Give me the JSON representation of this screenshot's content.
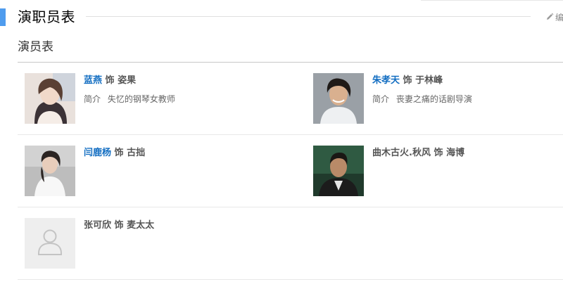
{
  "section": {
    "title": "演职员表",
    "edit_label": "编"
  },
  "cast": {
    "title": "演员表",
    "role_connector": "饰",
    "intro_label": "简介",
    "entries": [
      {
        "actor": "蓝燕",
        "role": "姿果",
        "intro": "失忆的钢琴女教师",
        "linked": true
      },
      {
        "actor": "朱孝天",
        "role": "于林峰",
        "intro": "丧妻之痛的话剧导演",
        "linked": true
      },
      {
        "actor": "闫鹿杨",
        "role": "古拙",
        "intro": "",
        "linked": true
      },
      {
        "actor": "曲木古火.秋风",
        "role": "海博",
        "intro": "",
        "linked": false
      },
      {
        "actor": "张可欣",
        "role": "麦太太",
        "intro": "",
        "linked": false
      }
    ]
  },
  "colors": {
    "accent": "#4f9cee",
    "link": "#136ec2"
  },
  "icons": {
    "edit": "pencil-icon",
    "placeholder": "person-placeholder-icon"
  }
}
